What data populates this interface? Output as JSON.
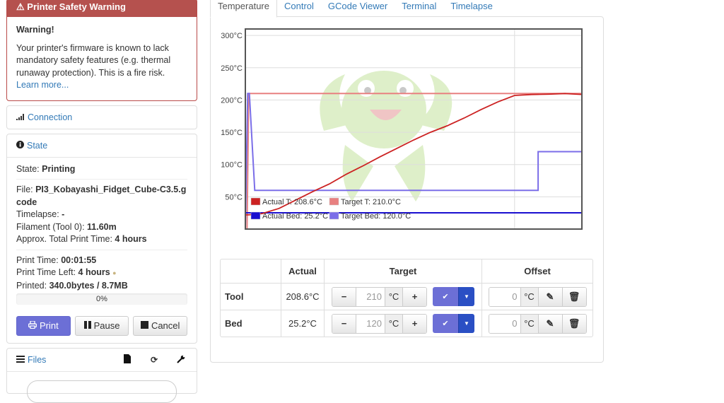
{
  "warning": {
    "title": "Printer Safety Warning",
    "heading": "Warning!",
    "body": "Your printer's firmware is known to lack mandatory safety features (e.g. thermal runaway protection). This is a fire risk.",
    "link": "Learn more..."
  },
  "connection": {
    "label": "Connection"
  },
  "state": {
    "title": "State",
    "state_label": "State: ",
    "state_value": "Printing",
    "file_label": "File: ",
    "file_value": "PI3_Kobayashi_Fidget_Cube-C3.5.gcode",
    "timelapse_label": "Timelapse: ",
    "timelapse_value": "-",
    "filament_label": "Filament (Tool 0): ",
    "filament_value": "11.60m",
    "approx_label": "Approx. Total Print Time: ",
    "approx_value": "4 hours",
    "print_time_label": "Print Time: ",
    "print_time_value": "00:01:55",
    "time_left_label": "Print Time Left: ",
    "time_left_value": "4 hours",
    "printed_label": "Printed: ",
    "printed_value": "340.0bytes / 8.7MB",
    "progress_percent": 0,
    "progress_text": "0%"
  },
  "buttons": {
    "print": "Print",
    "pause": "Pause",
    "cancel": "Cancel"
  },
  "files": {
    "label": "Files"
  },
  "tabs": [
    {
      "label": "Temperature",
      "active": true
    },
    {
      "label": "Control"
    },
    {
      "label": "GCode Viewer"
    },
    {
      "label": "Terminal"
    },
    {
      "label": "Timelapse"
    }
  ],
  "chart_data": {
    "type": "line",
    "title": "",
    "xlabel": "",
    "ylabel": "",
    "ylim": [
      0,
      310
    ],
    "xlim": [
      0,
      100
    ],
    "yticks": [
      "50°C",
      "100°C",
      "150°C",
      "200°C",
      "250°C",
      "300°C"
    ],
    "ytick_values": [
      50,
      100,
      150,
      200,
      250,
      300
    ],
    "legend_position": "bottom-left",
    "grid": true,
    "series": [
      {
        "name": "Actual T: 208.6°C",
        "color": "#cc2222",
        "x": [
          0,
          0.5,
          1,
          5,
          10,
          15,
          20,
          25,
          30,
          35,
          40,
          45,
          50,
          55,
          60,
          65,
          70,
          75,
          80,
          85,
          90,
          95,
          100
        ],
        "y": [
          22,
          22,
          22,
          24,
          32,
          45,
          58,
          70,
          85,
          98,
          112,
          125,
          138,
          150,
          160,
          172,
          185,
          197,
          207,
          208.5,
          209,
          210,
          208.6
        ]
      },
      {
        "name": "Target T: 210.0°C",
        "color": "#e88080",
        "x": [
          0,
          0.5,
          1,
          100
        ],
        "y": [
          0,
          0,
          210,
          210
        ]
      },
      {
        "name": "Actual Bed: 25.2°C",
        "color": "#1a0fd0",
        "x": [
          0,
          100
        ],
        "y": [
          25.2,
          25.2
        ]
      },
      {
        "name": "Target Bed: 120.0°C",
        "color": "#7b6ee8",
        "x": [
          0,
          0.7,
          1.2,
          2.8,
          87,
          87,
          100
        ],
        "y": [
          0,
          210,
          210,
          60,
          60,
          120,
          120
        ]
      }
    ],
    "vline_x": 80
  },
  "table": {
    "headers": [
      "",
      "Actual",
      "Target",
      "Offset"
    ],
    "rows": [
      {
        "name": "Tool",
        "actual": "208.6°C",
        "target": "210",
        "unit": "°C",
        "offset": "0"
      },
      {
        "name": "Bed",
        "actual": "25.2°C",
        "target": "120",
        "unit": "°C",
        "offset": "0"
      }
    ]
  }
}
